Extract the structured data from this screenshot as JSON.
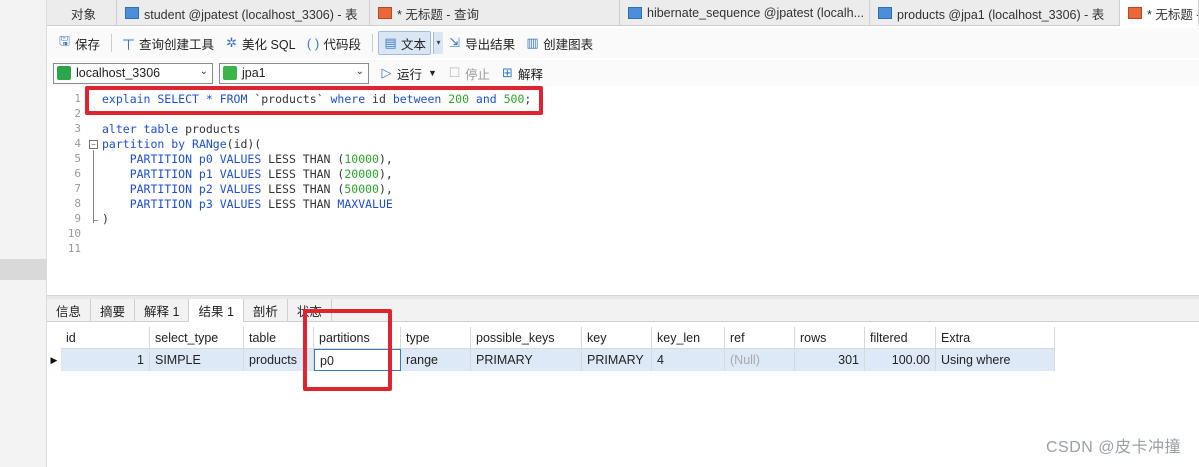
{
  "tabs": [
    {
      "label": "对象",
      "icon": "none",
      "active": false
    },
    {
      "label": "student @jpatest (localhost_3306) - 表",
      "icon": "table-icon",
      "active": false
    },
    {
      "label": "* 无标题 - 查询",
      "icon": "query-icon",
      "active": false
    },
    {
      "label": "hibernate_sequence @jpatest (localh...",
      "icon": "table-icon",
      "active": false
    },
    {
      "label": "products @jpa1 (localhost_3306) - 表",
      "icon": "table-icon",
      "active": false
    },
    {
      "label": "* 无标题 -",
      "icon": "query-icon",
      "active": true
    }
  ],
  "toolbar": {
    "save": "保存",
    "query_builder": "查询创建工具",
    "beautify": "美化 SQL",
    "snippet": "代码段",
    "text": "文本",
    "export": "导出结果",
    "create_chart": "创建图表"
  },
  "connbar": {
    "connection": "localhost_3306",
    "database": "jpa1",
    "run": "运行",
    "stop": "停止",
    "explain": "解释"
  },
  "editor": {
    "line_numbers": [
      "1",
      "2",
      "3",
      "4",
      "5",
      "6",
      "7",
      "8",
      "9",
      "10",
      "11"
    ],
    "lines": [
      [
        {
          "t": "explain SELECT * FROM ",
          "c": "kw"
        },
        {
          "t": "`products`",
          "c": "plain"
        },
        {
          "t": " where ",
          "c": "kw"
        },
        {
          "t": "id ",
          "c": "plain"
        },
        {
          "t": "between ",
          "c": "kw"
        },
        {
          "t": "200",
          "c": "num"
        },
        {
          "t": " and ",
          "c": "kw"
        },
        {
          "t": "500",
          "c": "num"
        },
        {
          "t": ";",
          "c": "plain"
        }
      ],
      [],
      [
        {
          "t": "alter table ",
          "c": "kw"
        },
        {
          "t": "products",
          "c": "plain"
        }
      ],
      [
        {
          "t": "partition by ",
          "c": "kw"
        },
        {
          "t": "RANge",
          "c": "kw"
        },
        {
          "t": "(id)(",
          "c": "plain"
        }
      ],
      [
        {
          "t": "    PARTITION p0 ",
          "c": "kw"
        },
        {
          "t": "VALUES ",
          "c": "kw"
        },
        {
          "t": "LESS THAN (",
          "c": "plain"
        },
        {
          "t": "10000",
          "c": "num"
        },
        {
          "t": "),",
          "c": "plain"
        }
      ],
      [
        {
          "t": "    PARTITION p1 ",
          "c": "kw"
        },
        {
          "t": "VALUES ",
          "c": "kw"
        },
        {
          "t": "LESS THAN (",
          "c": "plain"
        },
        {
          "t": "20000",
          "c": "num"
        },
        {
          "t": "),",
          "c": "plain"
        }
      ],
      [
        {
          "t": "    PARTITION p2 ",
          "c": "kw"
        },
        {
          "t": "VALUES ",
          "c": "kw"
        },
        {
          "t": "LESS THAN (",
          "c": "plain"
        },
        {
          "t": "50000",
          "c": "num"
        },
        {
          "t": "),",
          "c": "plain"
        }
      ],
      [
        {
          "t": "    PARTITION p3 ",
          "c": "kw"
        },
        {
          "t": "VALUES ",
          "c": "kw"
        },
        {
          "t": "LESS THAN ",
          "c": "plain"
        },
        {
          "t": "MAXVALUE",
          "c": "kw"
        }
      ],
      [
        {
          "t": ")",
          "c": "plain"
        }
      ],
      [],
      []
    ]
  },
  "result_tabs": [
    {
      "label": "信息",
      "active": false
    },
    {
      "label": "摘要",
      "active": false
    },
    {
      "label": "解释 1",
      "active": false
    },
    {
      "label": "结果 1",
      "active": true
    },
    {
      "label": "剖析",
      "active": false
    },
    {
      "label": "状态",
      "active": false
    }
  ],
  "grid": {
    "columns": [
      "id",
      "select_type",
      "table",
      "partitions",
      "type",
      "possible_keys",
      "key",
      "key_len",
      "ref",
      "rows",
      "filtered",
      "Extra"
    ],
    "rows": [
      [
        "1",
        "SIMPLE",
        "products",
        "p0",
        "range",
        "PRIMARY",
        "PRIMARY",
        "4",
        "(Null)",
        "301",
        "100.00",
        "Using where"
      ]
    ]
  },
  "watermark": "CSDN @皮卡冲撞",
  "colors": {
    "highlight_red": "#e0242f",
    "keyword_blue": "#1c4fd6",
    "number_green": "#2aa52a",
    "selected_row": "#dde9f7"
  }
}
